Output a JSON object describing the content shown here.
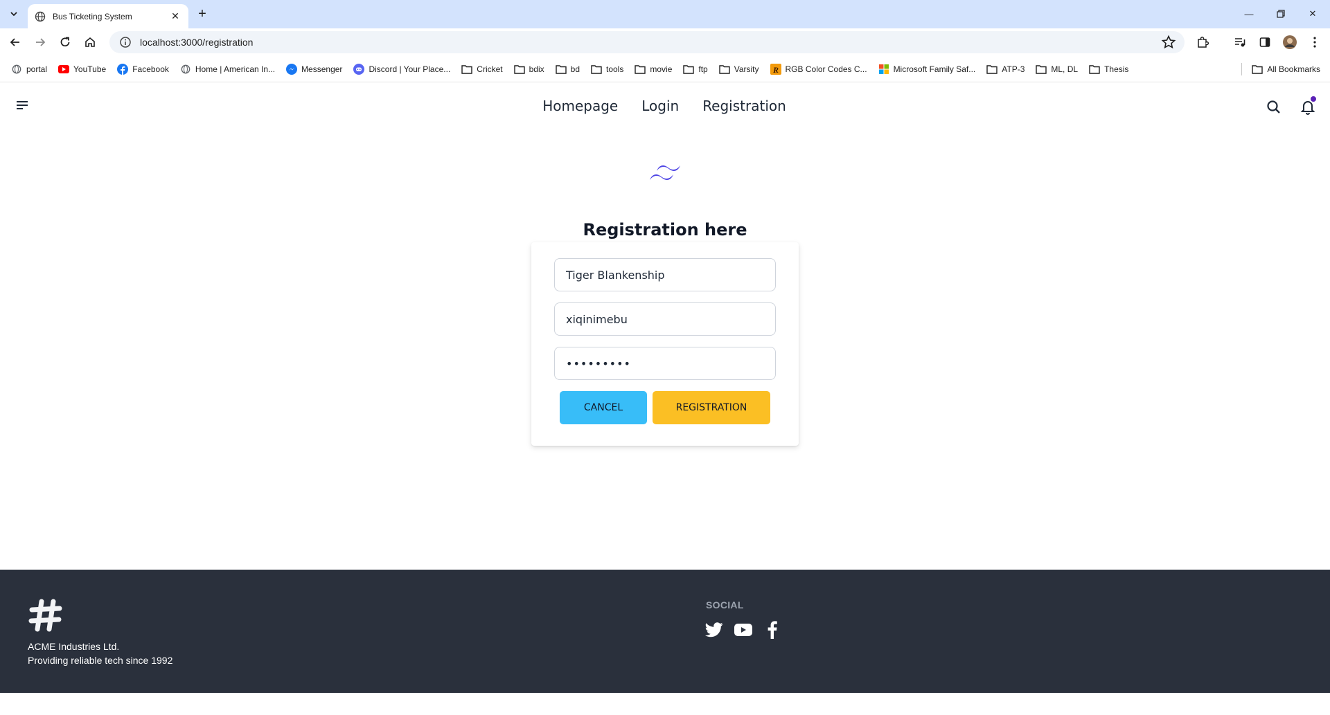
{
  "browser": {
    "tab_title": "Bus Ticketing System",
    "url": "localhost:3000/registration",
    "bookmarks": [
      {
        "label": "portal",
        "icon": "globe-icon"
      },
      {
        "label": "YouTube",
        "icon": "youtube-icon"
      },
      {
        "label": "Facebook",
        "icon": "facebook-icon"
      },
      {
        "label": "Home | American In...",
        "icon": "globe-icon"
      },
      {
        "label": "Messenger",
        "icon": "messenger-icon"
      },
      {
        "label": "Discord | Your Place...",
        "icon": "discord-icon"
      },
      {
        "label": "Cricket",
        "icon": "folder-icon"
      },
      {
        "label": "bdix",
        "icon": "folder-icon"
      },
      {
        "label": "bd",
        "icon": "folder-icon"
      },
      {
        "label": "tools",
        "icon": "folder-icon"
      },
      {
        "label": "movie",
        "icon": "folder-icon"
      },
      {
        "label": "ftp",
        "icon": "folder-icon"
      },
      {
        "label": "Varsity",
        "icon": "folder-icon"
      },
      {
        "label": "RGB Color Codes C...",
        "icon": "rgb-icon"
      },
      {
        "label": "Microsoft Family Saf...",
        "icon": "microsoft-icon"
      },
      {
        "label": "ATP-3",
        "icon": "folder-icon"
      },
      {
        "label": "ML, DL",
        "icon": "folder-icon"
      },
      {
        "label": "Thesis",
        "icon": "folder-icon"
      }
    ],
    "all_bookmarks_label": "All Bookmarks"
  },
  "nav": {
    "links": [
      "Homepage",
      "Login",
      "Registration"
    ]
  },
  "registration": {
    "title": "Registration here",
    "name_value": "Tiger Blankenship",
    "username_value": "xiqinimebu",
    "password_value": "•••••••••",
    "cancel_label": "CANCEL",
    "submit_label": "REGISTRATION"
  },
  "footer": {
    "company_line1": "ACME Industries Ltd.",
    "company_line2": "Providing reliable tech since 1992",
    "social_title": "SOCIAL",
    "social_icons": [
      "twitter-icon",
      "youtube-icon",
      "facebook-icon"
    ]
  },
  "colors": {
    "accent_logo": "#4f46e5",
    "cancel_button": "#38bdf8",
    "submit_button": "#fbbf24",
    "footer_bg": "#2a303c",
    "notification_dot": "#5b21b6"
  }
}
